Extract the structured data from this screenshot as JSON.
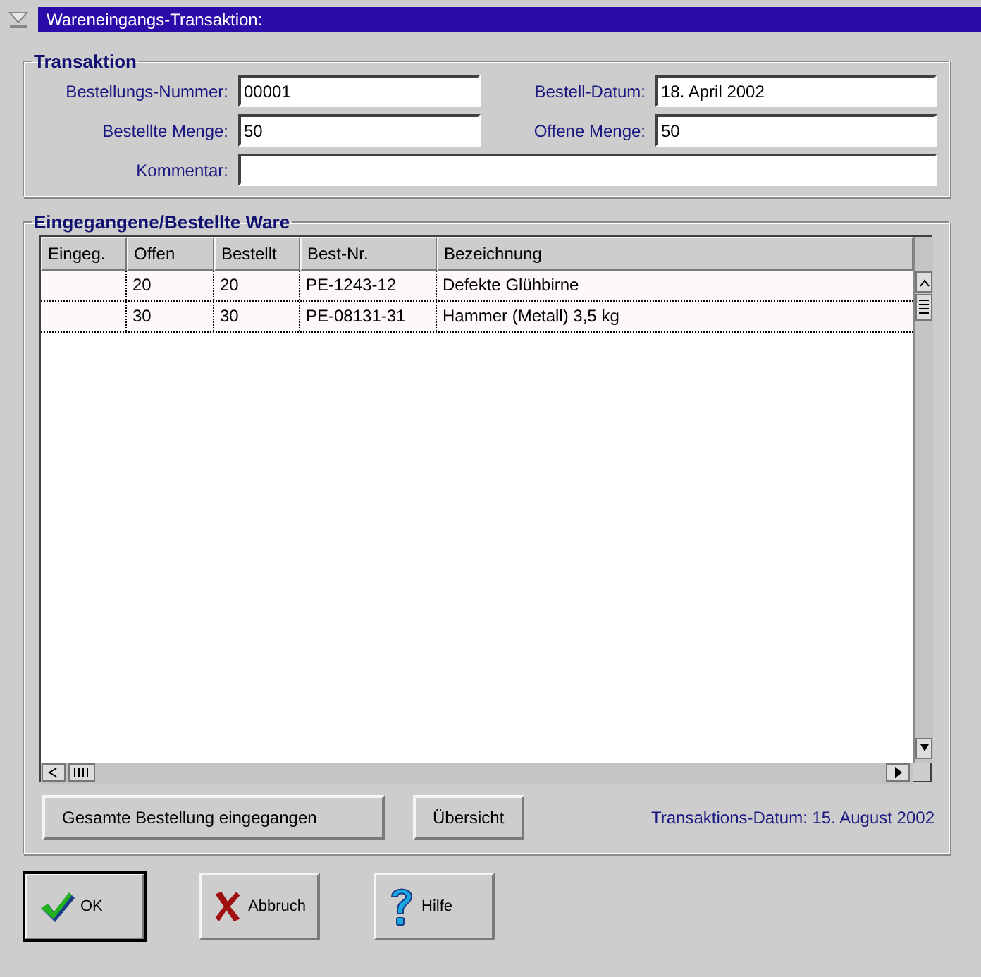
{
  "window": {
    "title": "Wareneingangs-Transaktion:"
  },
  "transaction": {
    "title": "Transaktion",
    "rows": [
      [
        {
          "label": "Bestellungs-Nummer:",
          "value": "00001"
        },
        {
          "label": "Bestell-Datum:",
          "value": "18. April 2002"
        }
      ],
      [
        {
          "label": "Bestellte Menge:",
          "value": "50"
        },
        {
          "label": "Offene Menge:",
          "value": "50"
        }
      ],
      [
        {
          "label": "Kommentar:"
        }
      ]
    ]
  },
  "goods": {
    "title": "Eingegangene/Bestellte Ware",
    "table": {
      "columns": [
        "Eingeg.",
        "Offen",
        "Bestellt",
        "Best-Nr.",
        "Bezeichnung"
      ],
      "rows": [
        {
          "cells": [
            "",
            "20",
            "20",
            "PE-1243-12",
            "Defekte Glühbirne"
          ]
        },
        {
          "cells": [
            "",
            "30",
            "30",
            "PE-08131-31",
            "Hammer (Metall) 3,5 kg"
          ]
        }
      ]
    },
    "actions": [
      {
        "label": "Gesamte Bestellung eingegangen"
      },
      {
        "label": "Übersicht"
      }
    ],
    "transaction_date": "Transaktions-Datum: 15. August 2002"
  },
  "buttons": [
    {
      "label": "OK",
      "kind": "ok",
      "default": true
    },
    {
      "label": "Abbruch",
      "kind": "cancel",
      "default": false
    },
    {
      "label": "Hilfe",
      "kind": "help",
      "default": false
    }
  ]
}
